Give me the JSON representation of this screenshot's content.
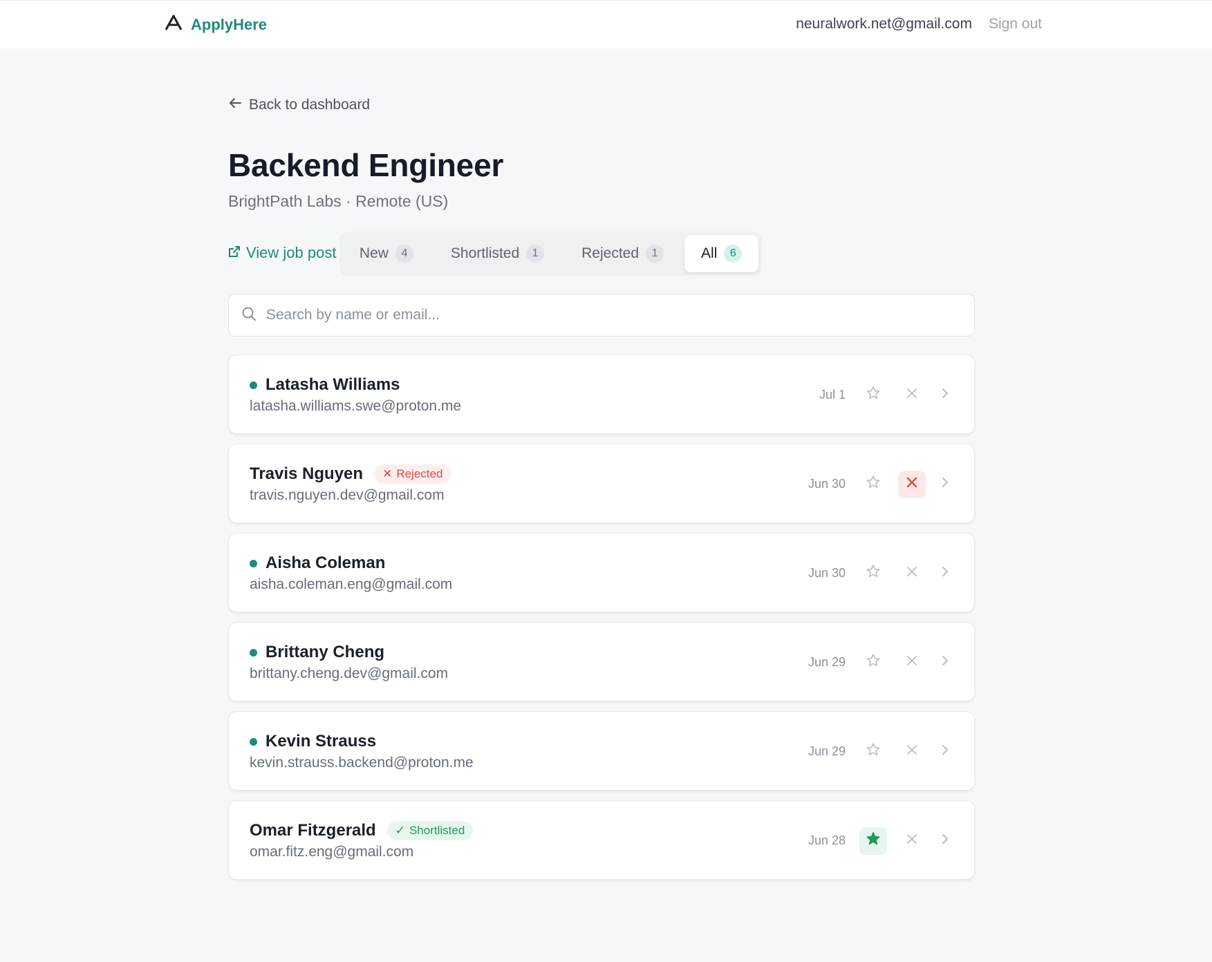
{
  "app": {
    "name": "ApplyHere",
    "logo_icon": "triangle-logo-icon"
  },
  "header": {
    "user_email": "neuralwork.net@gmail.com",
    "signout_label": "Sign out"
  },
  "nav": {
    "back_label": "Back to dashboard"
  },
  "job": {
    "title": "Backend Engineer",
    "subtitle": "BrightPath Labs · Remote (US)",
    "view_post_label": "View job post"
  },
  "tabs": [
    {
      "label": "New",
      "count": "4"
    },
    {
      "label": "Shortlisted",
      "count": "1"
    },
    {
      "label": "Rejected",
      "count": "1"
    },
    {
      "label": "All",
      "count": "6"
    }
  ],
  "active_tab": "All",
  "search": {
    "placeholder": "Search by name or email..."
  },
  "colors": {
    "accent": "#1e8a78",
    "rejected": "#e04848",
    "shortlisted": "#1f9a59"
  },
  "applicants": [
    {
      "name": "Latasha Williams",
      "email": "latasha.williams.swe@proton.me",
      "date": "Jul 1",
      "new": true,
      "status": "",
      "status_label": ""
    },
    {
      "name": "Travis Nguyen",
      "email": "travis.nguyen.dev@gmail.com",
      "date": "Jun 30",
      "new": false,
      "status": "rejected",
      "status_label": "Rejected"
    },
    {
      "name": "Aisha Coleman",
      "email": "aisha.coleman.eng@gmail.com",
      "date": "Jun 30",
      "new": true,
      "status": "",
      "status_label": ""
    },
    {
      "name": "Brittany Cheng",
      "email": "brittany.cheng.dev@gmail.com",
      "date": "Jun 29",
      "new": true,
      "status": "",
      "status_label": ""
    },
    {
      "name": "Kevin Strauss",
      "email": "kevin.strauss.backend@proton.me",
      "date": "Jun 29",
      "new": true,
      "status": "",
      "status_label": ""
    },
    {
      "name": "Omar Fitzgerald",
      "email": "omar.fitz.eng@gmail.com",
      "date": "Jun 28",
      "new": false,
      "status": "shortlisted",
      "status_label": "Shortlisted"
    }
  ]
}
